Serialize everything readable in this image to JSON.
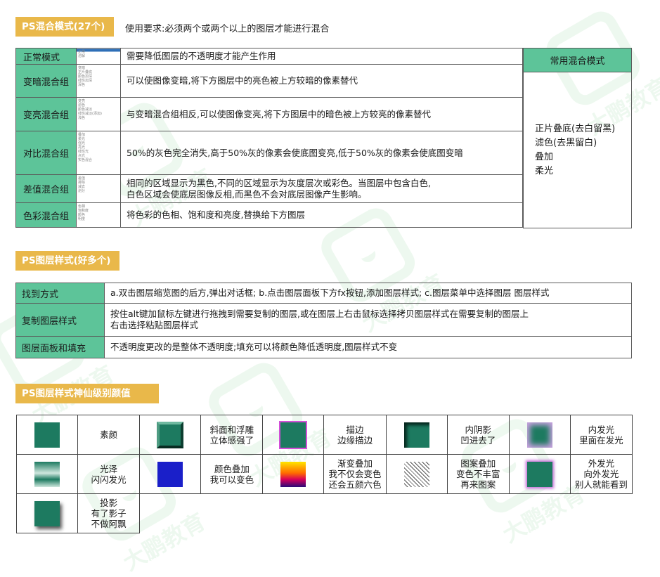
{
  "watermark": {
    "text": "大鹏教育"
  },
  "section1": {
    "title": "PS混合模式(27个)",
    "requirement": "使用要求:必须两个或两个以上的图层才能进行混合",
    "rows": [
      {
        "name": "正常模式",
        "thumb": [
          "正常",
          "溶解"
        ],
        "desc": "需要降低图层的不透明度才能产生作用"
      },
      {
        "name": "变暗混合组",
        "thumb": [
          "变暗",
          "正片叠底",
          "颜色加深",
          "线性加深",
          "深色"
        ],
        "desc": "可以使图像变暗,将下方图层中的亮色被上方较暗的像素替代"
      },
      {
        "name": "变亮混合组",
        "thumb": [
          "变亮",
          "滤色",
          "颜色减淡",
          "线性减淡(添加)",
          "浅色"
        ],
        "desc": "与变暗混合组相反,可以使图像变亮,将下方图层中的暗色被上方较亮的像素替代"
      },
      {
        "name": "对比混合组",
        "thumb": [
          "叠加",
          "柔光",
          "强光",
          "亮光",
          "线性光",
          "点光",
          "实色混合"
        ],
        "desc": "50%的灰色完全消失,高于50%灰的像素会使底图变亮,低于50%灰的像素会使底图变暗"
      },
      {
        "name": "差值混合组",
        "thumb": [
          "差值",
          "排除",
          "减去",
          "划分"
        ],
        "desc_line1": "相同的区域显示为黑色,不同的区域显示为灰度层次或彩色。当图层中包含白色,",
        "desc_line2": "白色区域会使底层图像反相,而黑色不会对底层图像产生影响。"
      },
      {
        "name": "色彩混合组",
        "thumb": [
          "色相",
          "饱和度",
          "颜色",
          "明度"
        ],
        "desc": "将色彩的色相、饱和度和亮度,替换给下方图层"
      }
    ],
    "side": {
      "title": "常用混合模式",
      "items": [
        "正片叠底(去白留黑)",
        "滤色(去黑留白)",
        "叠加",
        "柔光"
      ]
    }
  },
  "section2": {
    "title": "PS图层样式(好多个)",
    "rows": [
      {
        "name": "找到方式",
        "desc": "a.双击图层缩览图的后方,弹出对话框; b.点击图层面板下方fx按钮,添加图层样式; c.图层菜单中选择图层 图层样式"
      },
      {
        "name": "复制图层样式",
        "desc_line1": "按住alt键加鼠标左键进行拖拽到需要复制的图层,或在图层上右击鼠标选择拷贝图层样式在需要复制的图层上",
        "desc_line2": "右击选择粘贴图层样式"
      },
      {
        "name": "图层面板和填充",
        "desc": "不透明度更改的是整体不透明度;填充可以将颜色降低透明度,图层样式不变"
      }
    ]
  },
  "section3": {
    "title": "PS图层样式神仙级别颜值",
    "effects": [
      {
        "icon": "plain-swatch-icon",
        "l1": "素颜",
        "l2": ""
      },
      {
        "icon": "bevel-swatch-icon",
        "l1": "斜面和浮雕",
        "l2": "立体感强了"
      },
      {
        "icon": "stroke-swatch-icon",
        "l1": "描边",
        "l2": "边缘描边"
      },
      {
        "icon": "inner-shadow-swatch-icon",
        "l1": "内阴影",
        "l2": "凹进去了"
      },
      {
        "icon": "inner-glow-swatch-icon",
        "l1": "内发光",
        "l2": "里面在发光"
      },
      {
        "icon": "satin-swatch-icon",
        "l1": "光泽",
        "l2": "闪闪发光"
      },
      {
        "icon": "color-overlay-swatch-icon",
        "l1": "颜色叠加",
        "l2": "我可以变色"
      },
      {
        "icon": "gradient-overlay-swatch-icon",
        "l1": "渐变叠加",
        "l2": "我不仅会变色",
        "l3": "还会五颜六色"
      },
      {
        "icon": "pattern-overlay-swatch-icon",
        "l1": "图案叠加",
        "l2": "变色不丰富",
        "l3": "再来图案"
      },
      {
        "icon": "outer-glow-swatch-icon",
        "l1": "外发光",
        "l2": "向外发光",
        "l3": "别人就能看到"
      },
      {
        "icon": "drop-shadow-swatch-icon",
        "l1": "投影",
        "l2": "有了影子",
        "l3": "不做阿飘"
      }
    ]
  },
  "colors": {
    "accent": "#e9b84a",
    "green": "#5dc499",
    "swatch": "#1d7a60",
    "watermark": "#5cc46a"
  }
}
